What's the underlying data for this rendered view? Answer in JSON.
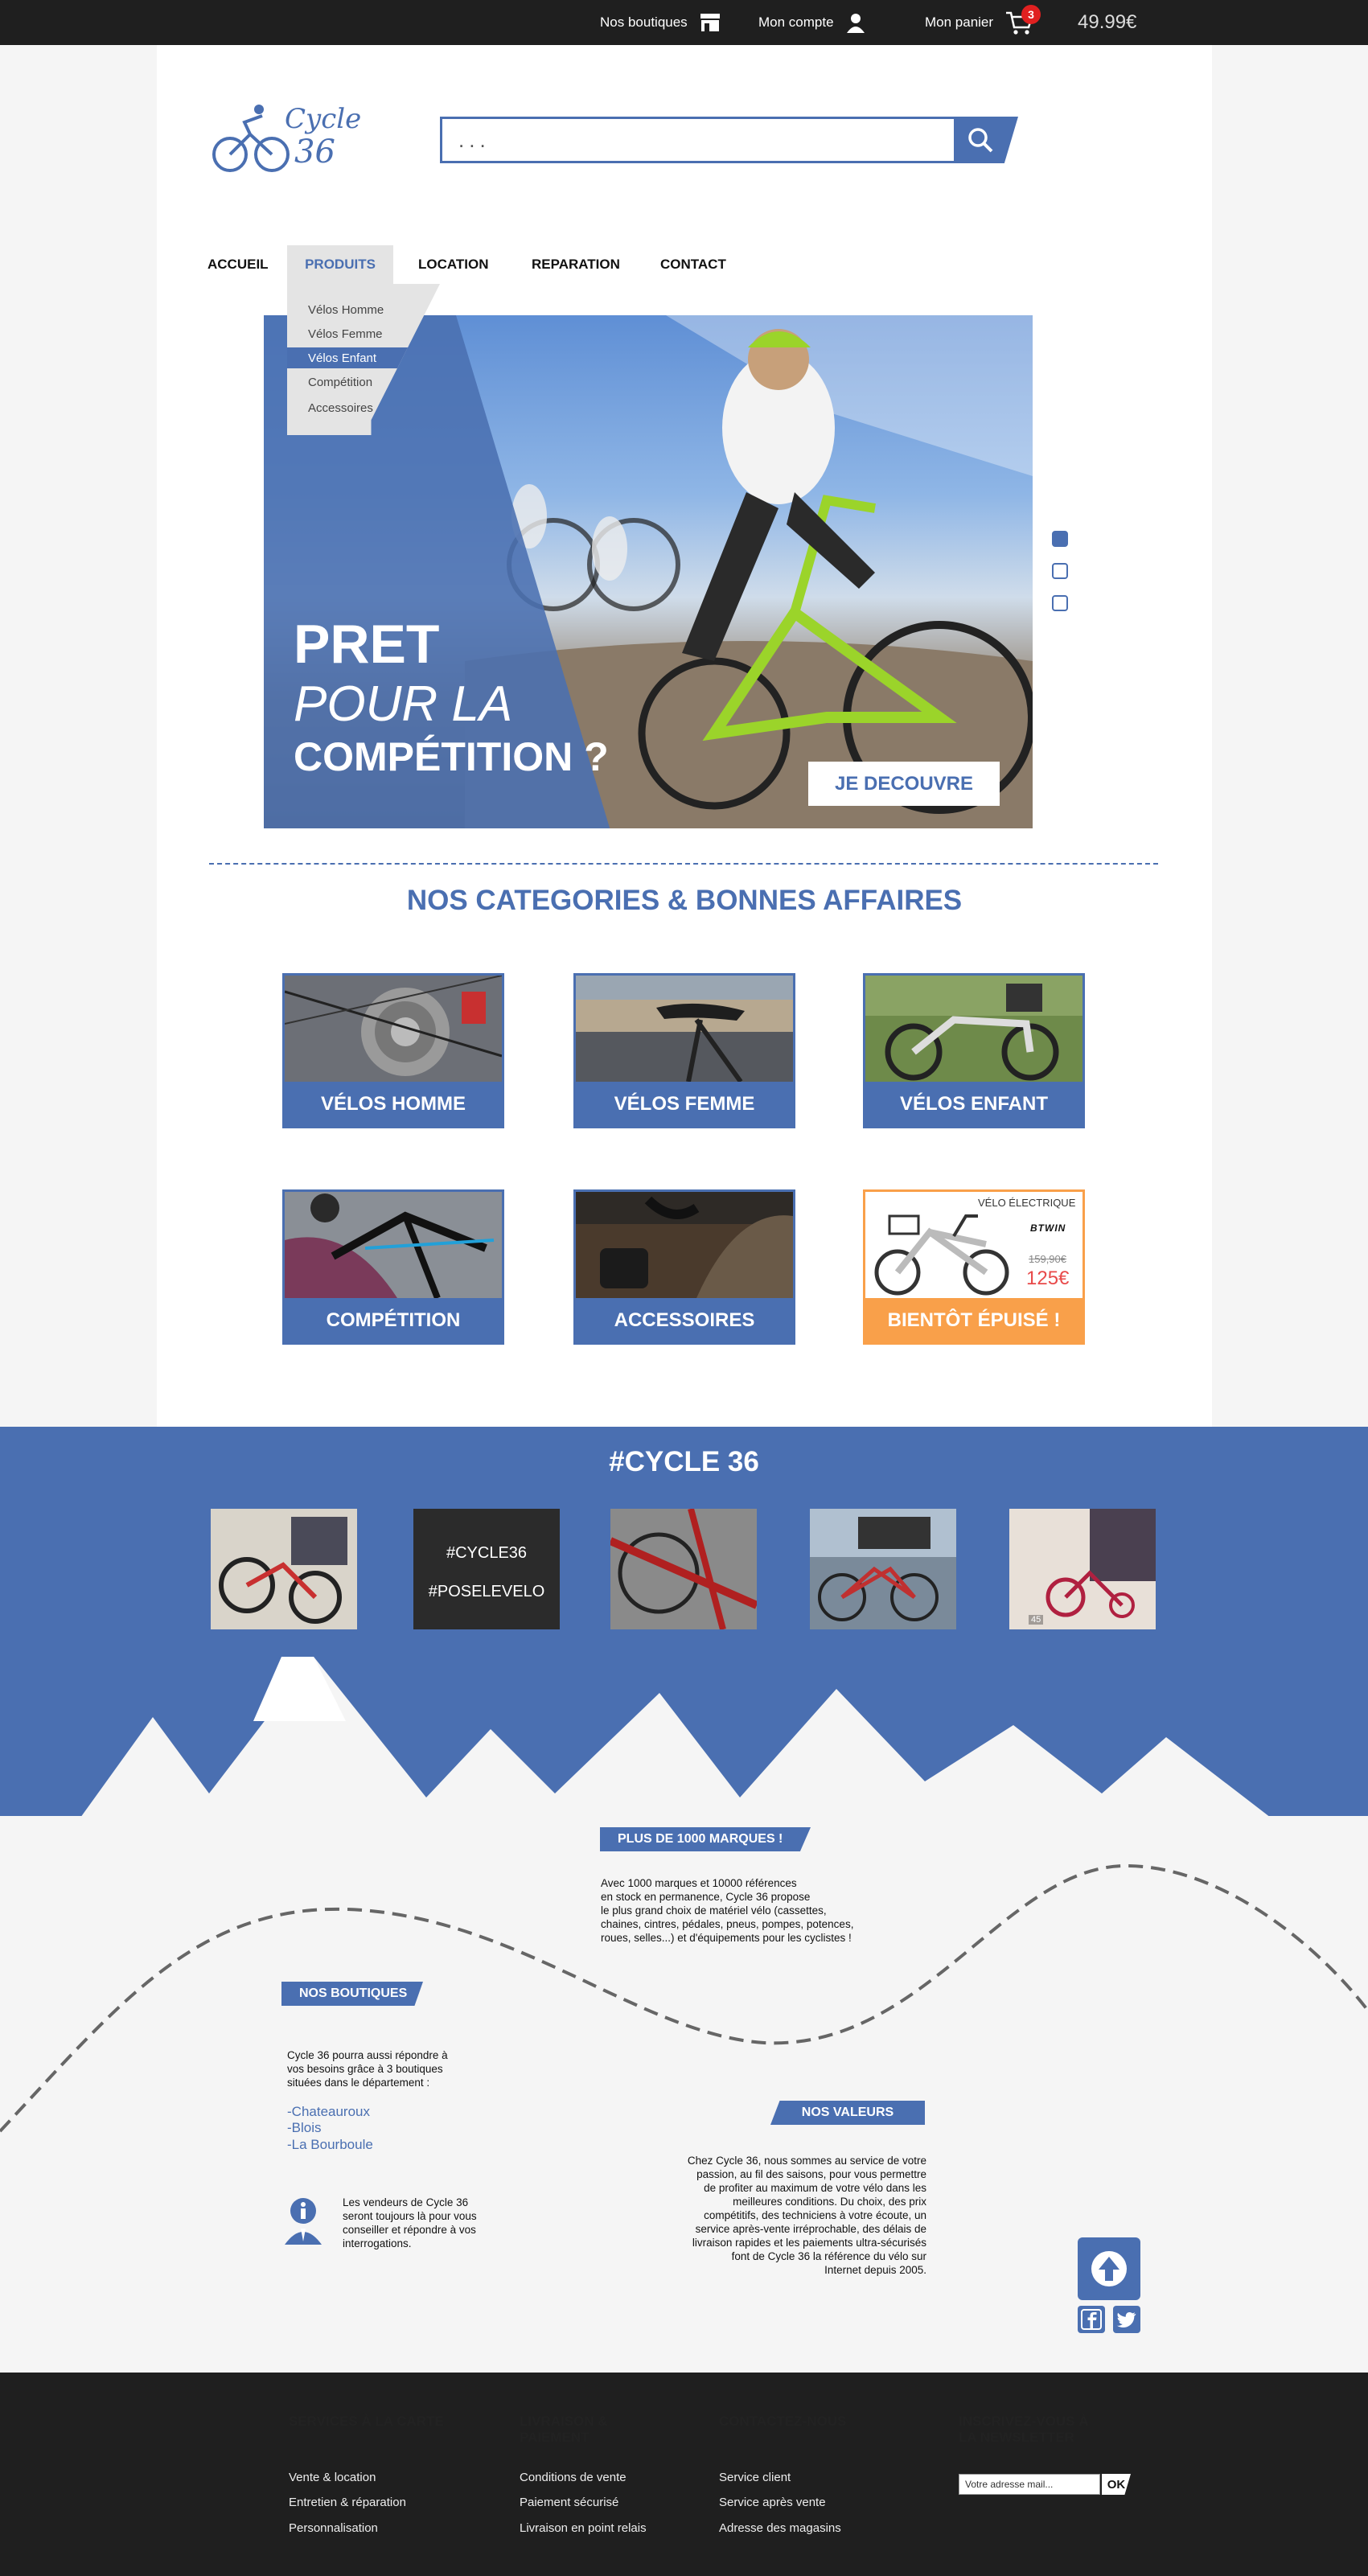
{
  "topbar": {
    "stores_label": "Nos boutiques",
    "account_label": "Mon compte",
    "cart_label": "Mon panier",
    "cart_count": "3",
    "cart_total": "49.99€"
  },
  "logo": {
    "line1": "Cycle",
    "line2": "36"
  },
  "search": {
    "placeholder": "..."
  },
  "nav": {
    "items": [
      "ACCUEIL",
      "PRODUITS",
      "LOCATION",
      "REPARATION",
      "CONTACT"
    ],
    "active": "PRODUITS",
    "dropdown": [
      "Vélos Homme",
      "Vélos Femme",
      "Vélos Enfant",
      "Compétition",
      "Accessoires"
    ],
    "dropdown_active": "Vélos Enfant"
  },
  "hero": {
    "line1": "PRET",
    "line2": "POUR LA",
    "line3": "COMPÉTITION ?",
    "cta": "JE DECOUVRE",
    "slide_active": 1,
    "slide_count": 3
  },
  "categories": {
    "title": "NOS CATEGORIES & BONNES AFFAIRES",
    "items": [
      {
        "label": "VÉLOS HOMME"
      },
      {
        "label": "VÉLOS FEMME"
      },
      {
        "label": "VÉLOS ENFANT"
      },
      {
        "label": "COMPÉTITION"
      },
      {
        "label": "ACCESSOIRES"
      },
      {
        "label": "BIENTÔT ÉPUISÉ !"
      }
    ],
    "deal": {
      "product": "VÉLO ÉLECTRIQUE",
      "brand": "BTWIN",
      "old_price": "159,90€",
      "new_price": "125€"
    }
  },
  "social_feed": {
    "title": "#CYCLE 36",
    "tag1": "#CYCLE36",
    "tag2": "#POSELEVELO",
    "photo_badge": "45"
  },
  "info": {
    "brands_tag": "PLUS DE 1000 MARQUES !",
    "brands_text": [
      "Avec 1000 marques et 10000 références",
      "en stock en permanence, Cycle 36 propose",
      "le plus grand choix de matériel vélo (cassettes,",
      "chaines, cintres, pédales, pneus, pompes, potences,",
      "roues, selles...) et d'équipements pour les cyclistes !"
    ],
    "stores_tag": "NOS BOUTIQUES",
    "stores_text": [
      "Cycle 36 pourra  aussi répondre à",
      "vos besoins grâce à 3  boutiques",
      "situées dans le département :"
    ],
    "cities": [
      "-Chateauroux",
      "-Blois",
      "-La Bourboule"
    ],
    "advice_text": [
      "Les vendeurs de Cycle 36",
      "seront toujours là pour vous",
      "conseiller et répondre à vos",
      "interrogations."
    ],
    "values_tag": "NOS VALEURS",
    "values_text": [
      "Chez Cycle 36, nous sommes au service de votre",
      "passion, au fil des saisons, pour vous permettre",
      "de profiter au maximum de votre vélo dans les",
      "meilleures conditions. Du choix, des prix",
      "compétitifs, des techniciens à votre écoute, un",
      "service après-vente irréprochable, des délais de",
      "livraison rapides et les paiements ultra-sécurisés",
      "font de Cycle 36 la référence du vélo sur",
      "Internet depuis 2005."
    ]
  },
  "footer": {
    "col1": {
      "title": "SERVICES À LA CARTE",
      "links": [
        "Vente & location",
        "Entretien & réparation",
        "Personnalisation"
      ]
    },
    "col2": {
      "title1": "LIVRAISON &",
      "title2": "PAIEMENT",
      "links": [
        "Conditions de vente",
        "Paiement sécurisé",
        "Livraison en point relais"
      ]
    },
    "col3": {
      "title": "CONTACTEZ-NOUS",
      "links": [
        "Service client",
        "Service après vente",
        "Adresse des magasins"
      ]
    },
    "col4": {
      "title1": "INSCRIVEZ-VOUS À",
      "title2": "LA NEWSLETTER",
      "placeholder": "Votre adresse mail...",
      "ok": "OK"
    }
  },
  "colors": {
    "brand_blue": "#4a6fb1",
    "deal_orange": "#f9a04a",
    "dark": "#1f1f1f",
    "badge_red": "#e02020"
  }
}
